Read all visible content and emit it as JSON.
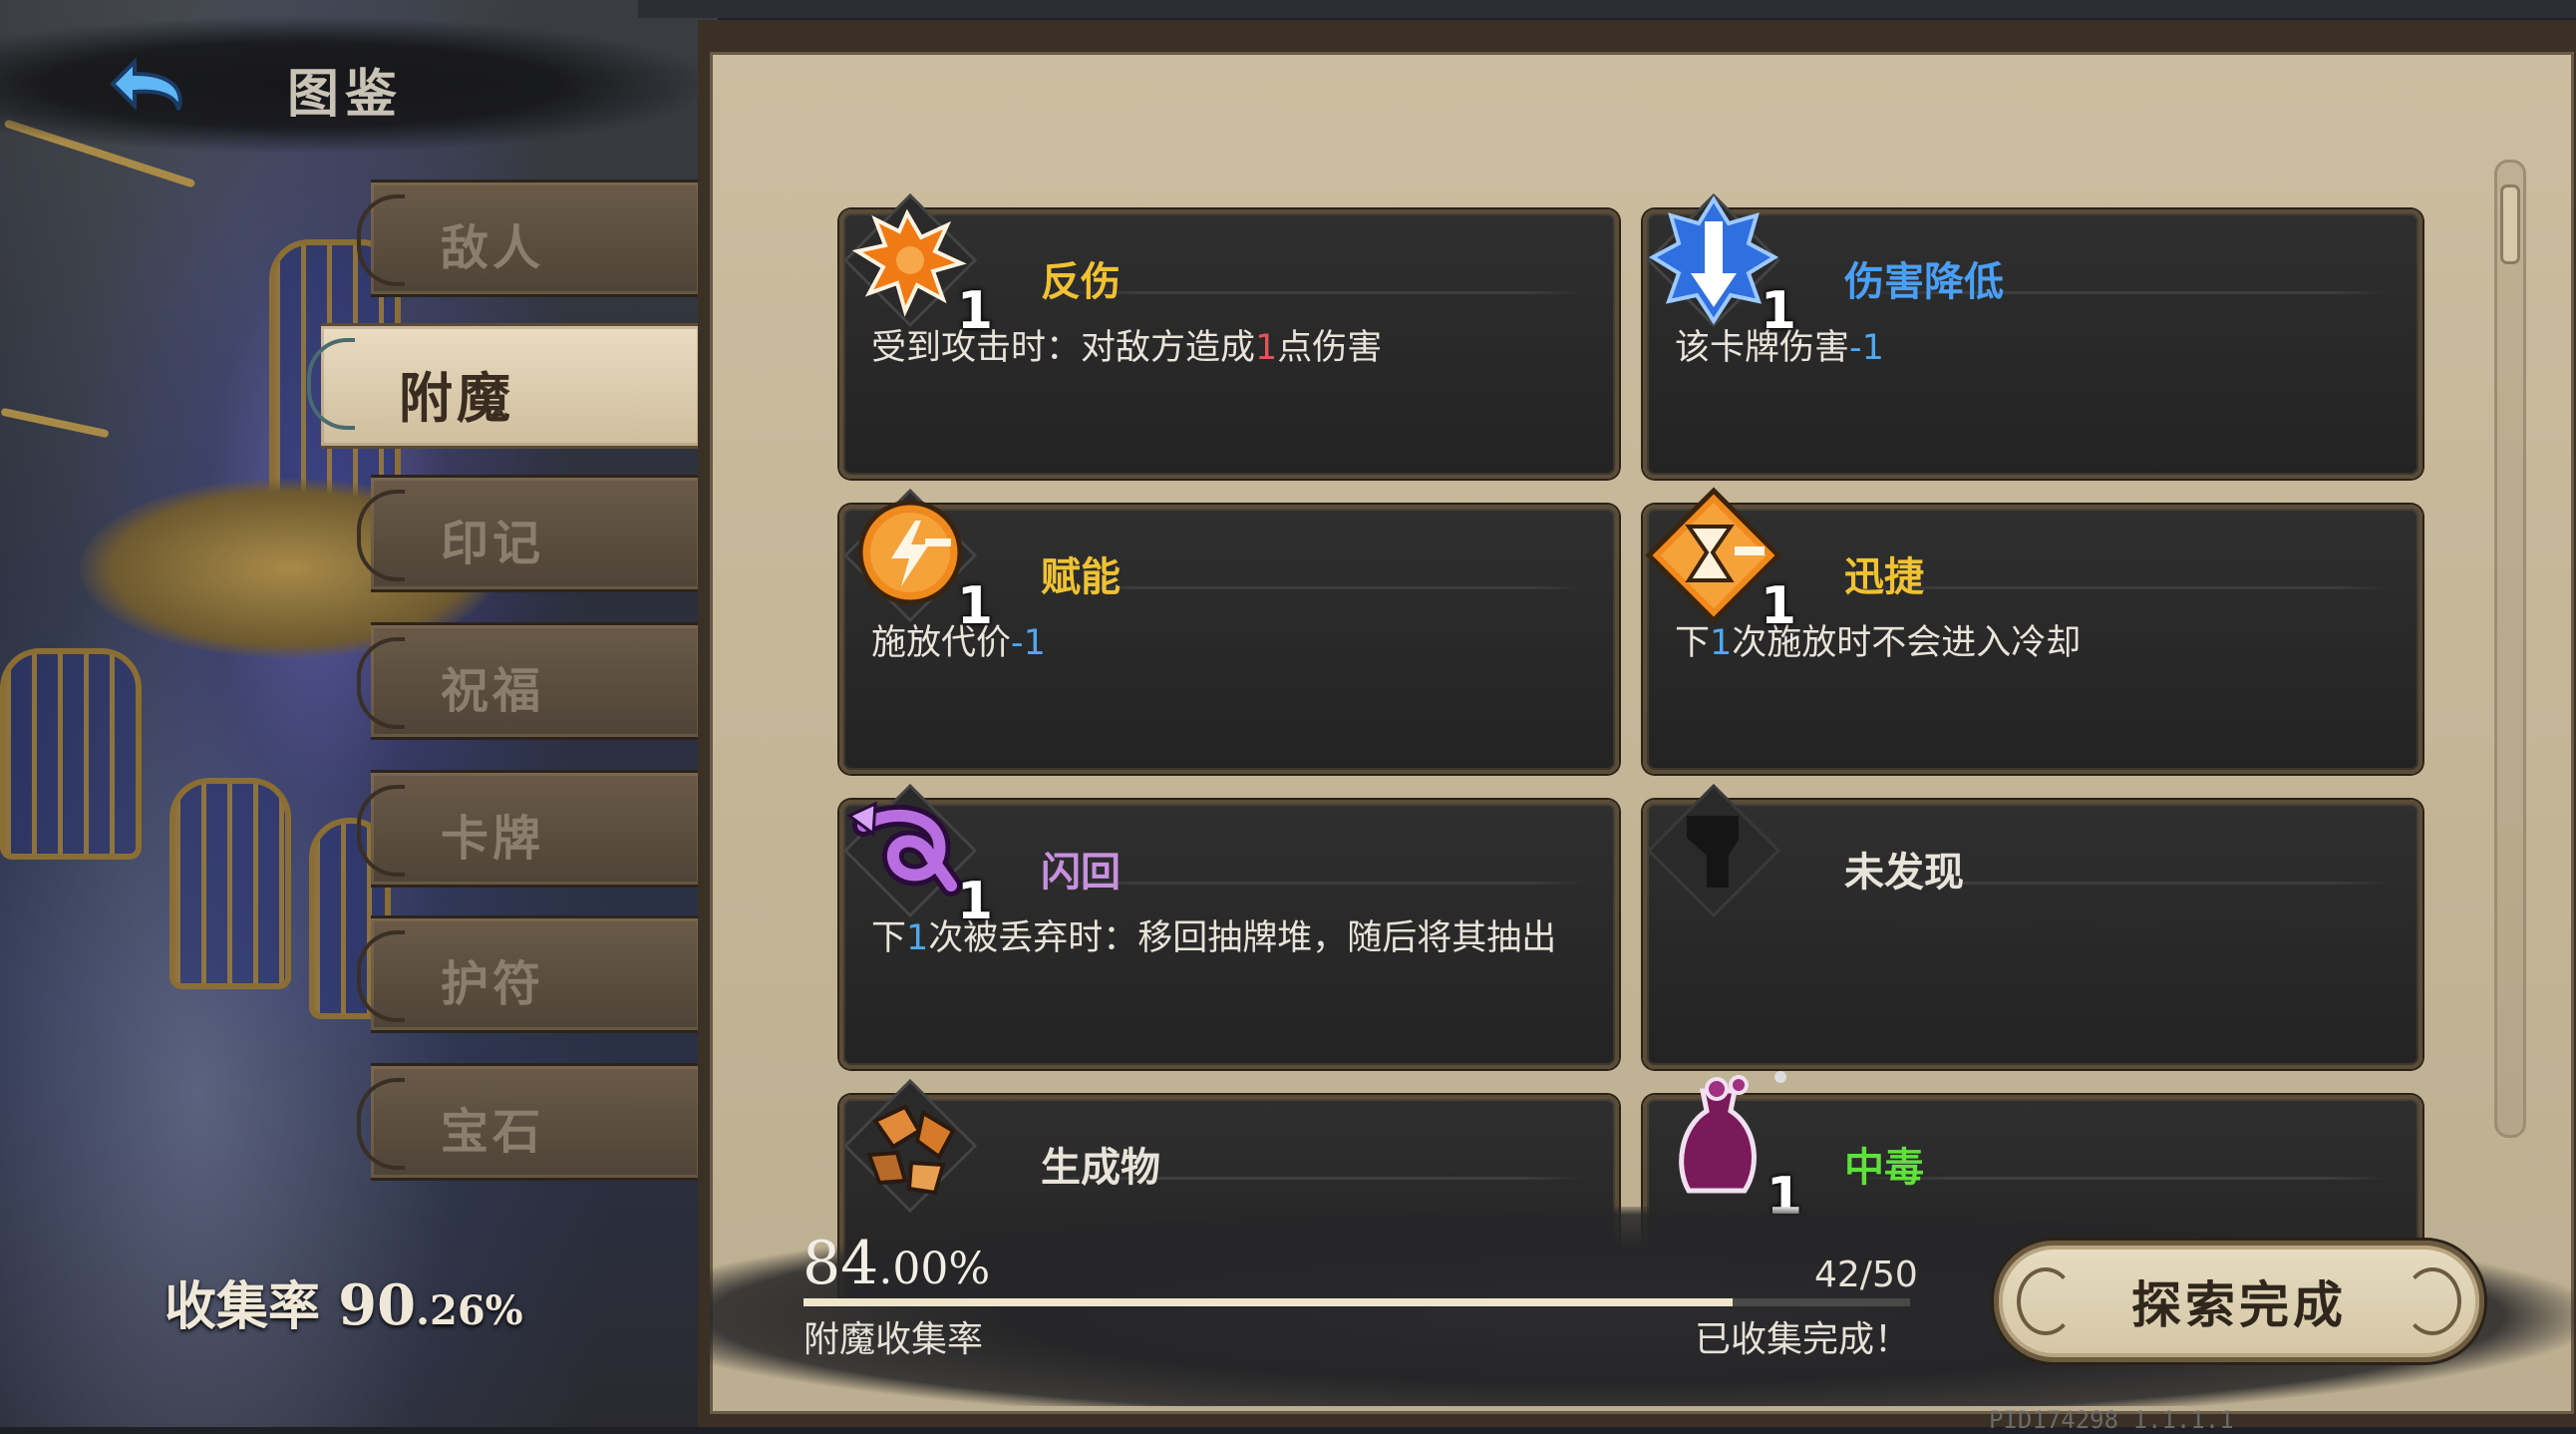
{
  "header": {
    "title": "图鉴",
    "back_icon": "back-arrow-icon"
  },
  "sidebar": {
    "tabs": [
      {
        "label": "敌人",
        "active": false
      },
      {
        "label": "附魔",
        "active": true
      },
      {
        "label": "印记",
        "active": false
      },
      {
        "label": "祝福",
        "active": false
      },
      {
        "label": "卡牌",
        "active": false
      },
      {
        "label": "护符",
        "active": false
      },
      {
        "label": "宝石",
        "active": false
      }
    ],
    "collection_label": "收集率",
    "collection_int": "90",
    "collection_dec": ".26%"
  },
  "entries": [
    {
      "name": "反伤",
      "level": "1",
      "name_color": "#f0c233",
      "icon": "thorns-burst-icon",
      "desc_pre": "受到攻击时：对敌方造成",
      "desc_num": "1",
      "desc_post": "点伤害"
    },
    {
      "name": "伤害降低",
      "level": "1",
      "name_color": "#4a9ff5",
      "icon": "damage-down-icon",
      "desc_pre": "该卡牌伤害",
      "desc_num": "-1",
      "desc_post": ""
    },
    {
      "name": "赋能",
      "level": "1",
      "name_color": "#f0c233",
      "icon": "lightning-orb-icon",
      "desc_pre": "施放代价",
      "desc_num": "-1",
      "desc_post": ""
    },
    {
      "name": "迅捷",
      "level": "1",
      "name_color": "#f0c233",
      "icon": "hourglass-icon",
      "desc_pre": "下",
      "desc_num": "1",
      "desc_post": "次施放时不会进入冷却"
    },
    {
      "name": "闪回",
      "level": "1",
      "name_color": "#c98fe0",
      "icon": "loop-arrow-icon",
      "desc_pre": "下",
      "desc_num": "1",
      "desc_post": "次被丢弃时：移回抽牌堆，随后将其抽出"
    },
    {
      "name": "未发现",
      "level": "",
      "name_color": "#e8e4da",
      "icon": "unknown-silhouette-icon",
      "desc_pre": "",
      "desc_num": "",
      "desc_post": ""
    },
    {
      "name": "生成物",
      "level": "",
      "name_color": "#e8e4da",
      "icon": "rock-chunks-icon",
      "desc_pre": "",
      "desc_num": "",
      "desc_post": ""
    },
    {
      "name": "中毒",
      "level": "1",
      "name_color": "#5fe03a",
      "icon": "poison-flask-icon",
      "desc_pre": "",
      "desc_num": "",
      "desc_post": ""
    }
  ],
  "footer": {
    "rate_int": "84",
    "rate_dec": ".00%",
    "rate_fraction": 0.84,
    "count": "42/50",
    "rate_label": "附魔收集率",
    "status": "已收集完成！",
    "explore_button": "探索完成",
    "pid": "PID174298  1.1.1.1"
  },
  "colors": {
    "gold_name": "#f0c233",
    "blue_name": "#4a9ff5",
    "purple_name": "#c98fe0",
    "green_name": "#5fe03a",
    "highlight_red": "#e0555a",
    "highlight_blue": "#4fa8f0",
    "parchment": "#c7b99b"
  }
}
